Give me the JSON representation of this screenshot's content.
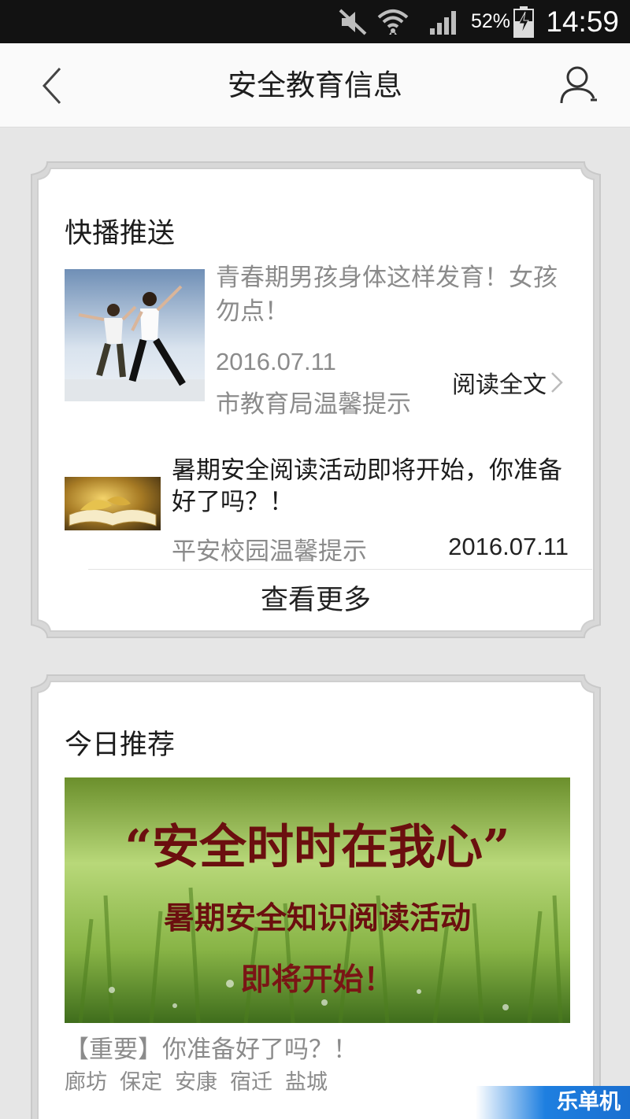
{
  "status_bar": {
    "battery_percent": "52%",
    "time": "14:59",
    "icons": [
      "mute-icon",
      "wifi-icon",
      "signal-icon",
      "battery-charging-icon"
    ]
  },
  "header": {
    "title": "安全教育信息",
    "back_icon": "chevron-left-icon",
    "user_icon": "user-icon"
  },
  "news_card": {
    "title": "快播推送",
    "items": [
      {
        "title": "青春期男孩身体这样发育！女孩勿点！",
        "date": "2016.07.11",
        "source": "市教育局温馨提示",
        "read_more": "阅读全文"
      },
      {
        "title": "暑期安全阅读活动即将开始，你准备好了吗？！",
        "source": "平安校园温馨提示",
        "date": "2016.07.11"
      }
    ],
    "view_more": "查看更多"
  },
  "recommend_card": {
    "title": "今日推荐",
    "banner": {
      "line1": "“安全时时在我心”",
      "line2": "暑期安全知识阅读活动",
      "line3": "即将开始！"
    },
    "caption": "【重要】你准备好了吗？！",
    "tags": [
      "廊坊",
      "保定",
      "安康",
      "宿迁",
      "盐城"
    ]
  },
  "watermark": "乐单机",
  "colors": {
    "page_bg": "#e6e6e6",
    "status_bar_bg": "#121212",
    "header_bg": "#fafafa",
    "muted_text": "#8b8b8b",
    "banner_text": "#6b0f0f"
  }
}
